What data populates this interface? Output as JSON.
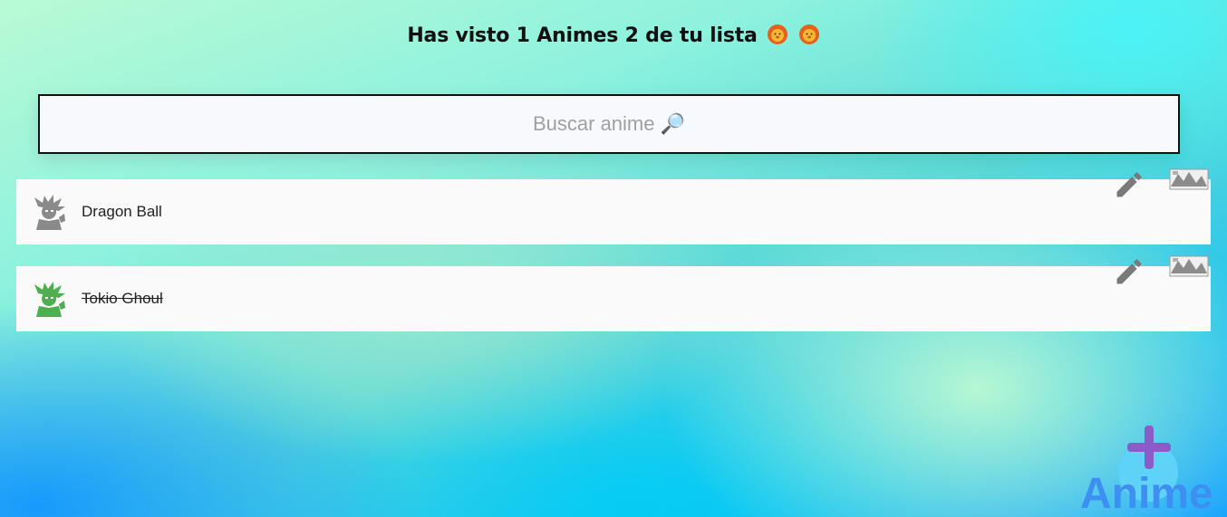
{
  "header": {
    "title": "Has visto 1 Animes 2 de tu lista",
    "emojis": [
      "lion-face-icon",
      "lion-face-icon"
    ]
  },
  "search": {
    "placeholder": "Buscar anime 🔎",
    "value": ""
  },
  "anime_list": [
    {
      "name": "Dragon Ball",
      "watched": false,
      "avatar_icon": "goku-icon-gray"
    },
    {
      "name": "Tokio Ghoul",
      "watched": true,
      "avatar_icon": "goku-icon-green"
    }
  ],
  "row_actions": {
    "edit_icon": "pencil-icon",
    "delete_icon": "broken-image-icon"
  },
  "add_button": {
    "icon": "plus-icon",
    "label": "Anime"
  },
  "colors": {
    "title": "#111111",
    "fab_bg": "#5fd3f7",
    "plus": "#8a5cc8",
    "fab_label": "#3d8ff2",
    "avatar_unwatched": "#8a8a8a",
    "avatar_watched": "#4fae4f",
    "edit_icon": "#7a7a7a"
  }
}
